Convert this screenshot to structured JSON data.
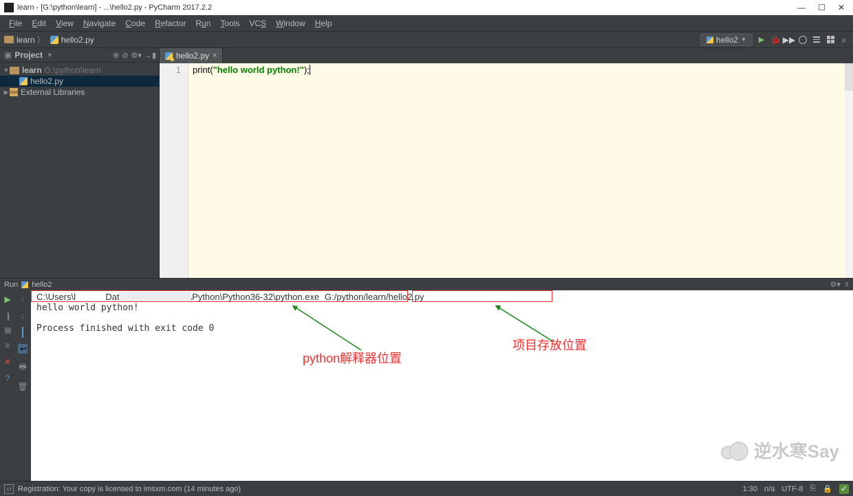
{
  "title": "learn - [G:\\python\\learn] - ...\\hello2.py - PyCharm 2017.2.2",
  "menu": [
    "File",
    "Edit",
    "View",
    "Navigate",
    "Code",
    "Refactor",
    "Run",
    "Tools",
    "VCS",
    "Window",
    "Help"
  ],
  "breadcrumb": {
    "folder": "learn",
    "file": "hello2.py"
  },
  "run_config": "hello2",
  "project_panel": {
    "title": "Project",
    "tree": {
      "root": {
        "name": "learn",
        "path": "G:\\python\\learn"
      },
      "file": "hello2.py",
      "ext": "External Libraries"
    }
  },
  "tab": {
    "name": "hello2.py"
  },
  "code": {
    "line_no": "1",
    "prefix": "print(",
    "string": "\"hello world python!\"",
    "suffix": ");"
  },
  "run_head": "hello2",
  "run_label": "Run",
  "console": {
    "path1": "C:\\Users\\l            Data\\Local\\Programs\\Python\\Python36-32\\python.exe",
    "path2": "G:/python/learn/hello2.py",
    "out": "hello world python!",
    "exit": "Process finished with exit code 0"
  },
  "annotations": {
    "interp": "python解释器位置",
    "proj": "项目存放位置"
  },
  "watermark": "逆水寒Say",
  "status": {
    "msg": "Registration: Your copy is licensed to imsxm.com (14 minutes ago)",
    "pos": "1:30",
    "ctx": "n/a",
    "enc": "UTF-8",
    "ins": "⎘"
  }
}
